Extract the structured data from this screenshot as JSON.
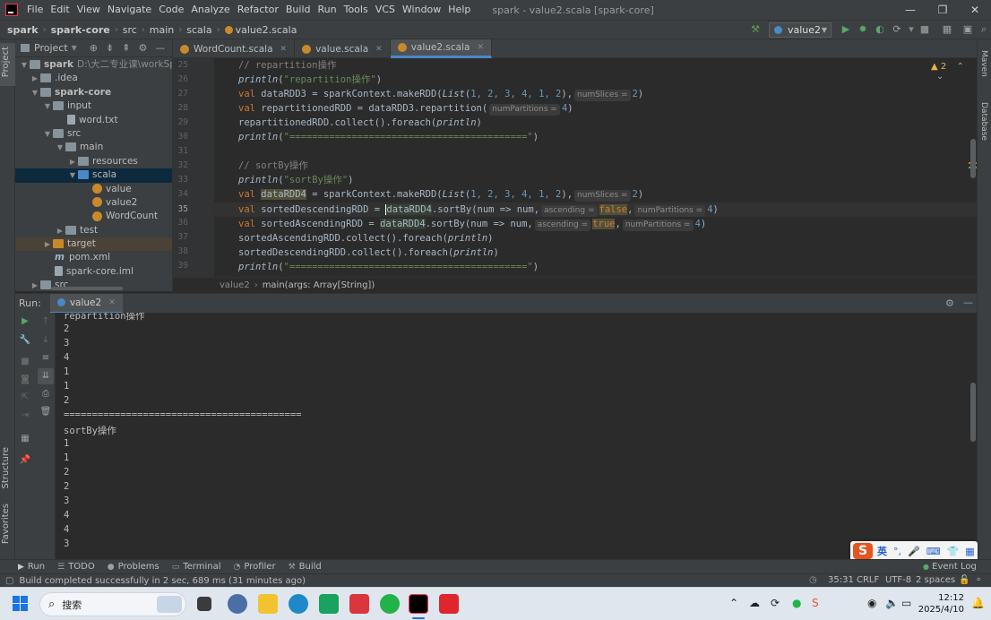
{
  "titlebar": {
    "menu": [
      "File",
      "Edit",
      "View",
      "Navigate",
      "Code",
      "Analyze",
      "Refactor",
      "Build",
      "Run",
      "Tools",
      "VCS",
      "Window",
      "Help"
    ],
    "title": "spark - value2.scala [spark-core]"
  },
  "navbar": {
    "crumbs": [
      "spark",
      "spark-core",
      "src",
      "main",
      "scala",
      "value2.scala"
    ],
    "run_config": "value2"
  },
  "left_stripe": {
    "project": "Project",
    "structure": "Structure",
    "favorites": "Favorites"
  },
  "right_stripe": {
    "maven": "Maven",
    "database": "Database"
  },
  "project": {
    "header": "Project",
    "tree": [
      {
        "label": "spark",
        "path": "D:\\大二专业课\\workSpace\\",
        "bold": true
      },
      {
        "label": ".idea"
      },
      {
        "label": "spark-core",
        "bold": true
      },
      {
        "label": "input"
      },
      {
        "label": "word.txt"
      },
      {
        "label": "src"
      },
      {
        "label": "main"
      },
      {
        "label": "resources"
      },
      {
        "label": "scala"
      },
      {
        "label": "value"
      },
      {
        "label": "value2"
      },
      {
        "label": "WordCount"
      },
      {
        "label": "test"
      },
      {
        "label": "target"
      },
      {
        "label": "pom.xml"
      },
      {
        "label": "spark-core.iml"
      },
      {
        "label": "src"
      }
    ]
  },
  "editor": {
    "tabs": [
      {
        "label": "WordCount.scala"
      },
      {
        "label": "value.scala"
      },
      {
        "label": "value2.scala"
      }
    ],
    "warning_count": "2",
    "line_numbers": [
      "25",
      "26",
      "27",
      "28",
      "29",
      "30",
      "31",
      "32",
      "33",
      "34",
      "35",
      "36",
      "37",
      "38",
      "39"
    ],
    "lines": {
      "l25": "// repartition操作",
      "l26_fn": "println",
      "l26_str": "\"repartition操作\"",
      "l27_a": "val ",
      "l27_b": "dataRDD3 = sparkContext.makeRDD(",
      "l27_list": "List",
      "l27_c": "(",
      "l27_nums": "1, 2, 3, 4, 1, 2",
      "l27_d": "),",
      "l27_hint": "numSlices =",
      "l27_n": "2",
      "l27_e": ")",
      "l28_a": "val ",
      "l28_b": "repartitionedRDD = dataRDD3.repartition(",
      "l28_hint": "numPartitions =",
      "l28_n": "4",
      "l28_e": ")",
      "l29": "repartitionedRDD.collect().foreach(",
      "l29_fn": "println",
      "l29_e": ")",
      "l30_fn": "println",
      "l30_str": "\"==========================================\"",
      "l32": "// sortBy操作",
      "l33_fn": "println",
      "l33_str": "\"sortBy操作\"",
      "l34_a": "val ",
      "l34_b": "dataRDD4",
      "l34_c": " = sparkContext.makeRDD(",
      "l34_list": "List",
      "l34_d": "(",
      "l34_nums": "1, 2, 3, 4, 1, 2",
      "l34_e": "),",
      "l34_hint": "numSlices =",
      "l34_n": "2",
      "l34_f": ")",
      "l35_a": "val ",
      "l35_b": "sortedDescendingRDD = ",
      "l35_c": "dataRDD4",
      "l35_d": ".sortBy(num => num,",
      "l35_hint1": "ascending =",
      "l35_kw": "false",
      "l35_e": ",",
      "l35_hint2": "numPartitions =",
      "l35_n": "4",
      "l35_f": ")",
      "l36_a": "val ",
      "l36_b": "sortedAscendingRDD = ",
      "l36_c": "dataRDD4",
      "l36_d": ".sortBy(num => num,",
      "l36_hint1": "ascending =",
      "l36_kw": "true",
      "l36_e": ",",
      "l36_hint2": "numPartitions =",
      "l36_n": "4",
      "l36_f": ")",
      "l37": "sortedAscendingRDD.collect().foreach(",
      "l37_fn": "println",
      "l37_e": ")",
      "l38": "sortedDescendingRDD.collect().foreach(",
      "l38_fn": "println",
      "l38_e": ")",
      "l39_fn": "println",
      "l39_str": "\"==========================================\""
    },
    "crumbs": [
      "value2",
      "main(args: Array[String])"
    ]
  },
  "run": {
    "label": "Run:",
    "tab": "value2",
    "console": [
      "repartition操作",
      "2",
      "3",
      "4",
      "1",
      "1",
      "2",
      "==========================================",
      "sortBy操作",
      "1",
      "1",
      "2",
      "2",
      "3",
      "4",
      "4",
      "3"
    ]
  },
  "bottom_tools": [
    "Run",
    "TODO",
    "Problems",
    "Terminal",
    "Profiler",
    "Build"
  ],
  "event_log": "Event Log",
  "status": {
    "message": "Build completed successfully in 2 sec, 689 ms (31 minutes ago)",
    "position": "35:31",
    "line_sep": "CRLF",
    "encoding": "UTF-8",
    "indent": "2 spaces"
  },
  "ime": {
    "lang": "英"
  },
  "taskbar": {
    "search_placeholder": "搜索",
    "time": "12:12",
    "date": "2025/4/10"
  },
  "colors": {
    "accent": "#4a88c7",
    "keyword": "#cc7832",
    "string": "#6a8759",
    "number": "#6897bb",
    "comment": "#808080"
  }
}
